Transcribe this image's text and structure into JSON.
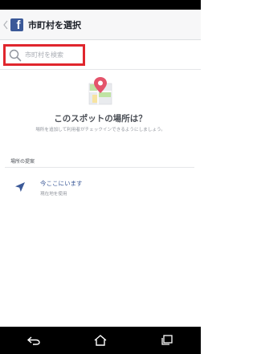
{
  "app_bar": {
    "title": "市町村を選択",
    "back_icon": "chevron-left-icon",
    "logo_icon": "facebook-logo-icon",
    "brand_color": "#3b5998"
  },
  "search": {
    "placeholder": "市町村を検索",
    "icon": "search-icon",
    "highlight_color": "#e0262d"
  },
  "empty_state": {
    "illustration": "map-pin-icon",
    "title": "このスポットの場所は？",
    "description": "場所を追加して利用者がチェックインできるようにしましょう。"
  },
  "suggestions": {
    "header": "場所の提案",
    "items": [
      {
        "icon": "location-arrow-icon",
        "title": "今ここにいます",
        "subtitle": "現在地を使用"
      }
    ]
  },
  "nav_bar": {
    "back_icon": "back-icon",
    "home_icon": "home-icon",
    "recents_icon": "recent-apps-icon"
  }
}
